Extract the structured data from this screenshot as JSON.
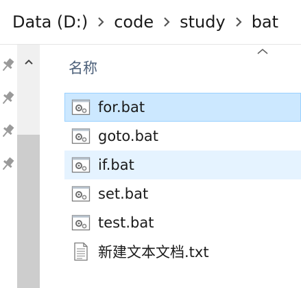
{
  "breadcrumb": {
    "items": [
      {
        "label": "Data (D:)"
      },
      {
        "label": "code"
      },
      {
        "label": "study"
      },
      {
        "label": "bat"
      }
    ]
  },
  "nav_pane": {
    "pins": [
      "pin-icon",
      "pin-icon",
      "pin-icon",
      "pin-icon"
    ]
  },
  "content": {
    "column_header": "名称",
    "files": [
      {
        "name": "for.bat",
        "icon": "batch-file-icon",
        "state": "selected"
      },
      {
        "name": "goto.bat",
        "icon": "batch-file-icon",
        "state": "normal"
      },
      {
        "name": "if.bat",
        "icon": "batch-file-icon",
        "state": "hover"
      },
      {
        "name": "set.bat",
        "icon": "batch-file-icon",
        "state": "normal"
      },
      {
        "name": "test.bat",
        "icon": "batch-file-icon",
        "state": "normal"
      },
      {
        "name": "新建文本文档.txt",
        "icon": "text-file-icon",
        "state": "normal"
      }
    ]
  },
  "colors": {
    "selected_bg": "#cce8ff",
    "selected_border": "#99d1ff",
    "hover_bg": "#e5f3ff",
    "header_text": "#4c607a"
  }
}
